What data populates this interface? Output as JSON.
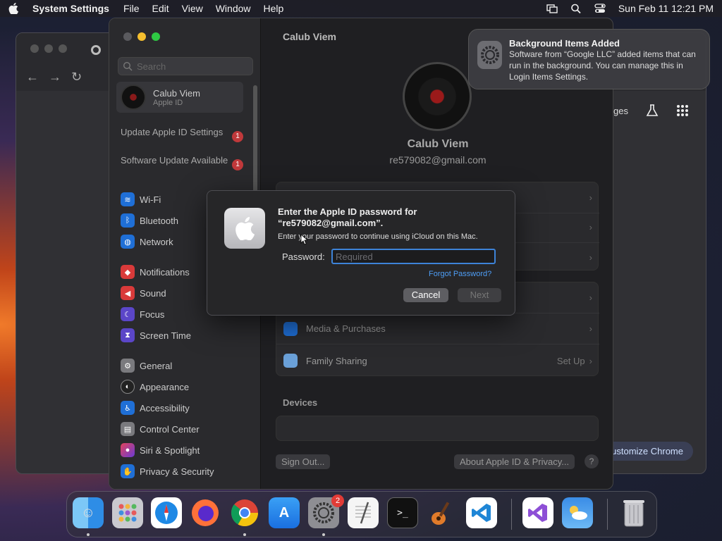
{
  "menubar": {
    "app_name": "System Settings",
    "menus": [
      "File",
      "Edit",
      "View",
      "Window",
      "Help"
    ],
    "datetime": "Sun Feb 11  12:21 PM"
  },
  "chrome": {
    "partial_label": "ges",
    "customize_label": "ustomize Chrome"
  },
  "settings": {
    "search_placeholder": "Search",
    "account_name": "Calub Viem",
    "account_sub": "Apple ID",
    "notices": [
      {
        "label": "Update Apple ID Settings",
        "badge": "1"
      },
      {
        "label": "Software Update Available",
        "badge": "1"
      }
    ],
    "nav": [
      "Wi-Fi",
      "Bluetooth",
      "Network",
      "Notifications",
      "Sound",
      "Focus",
      "Screen Time",
      "General",
      "Appearance",
      "Accessibility",
      "Control Center",
      "Siri & Spotlight",
      "Privacy & Security"
    ],
    "main_title": "Calub Viem",
    "user_name": "Calub Viem",
    "user_email": "re579082@gmail.com",
    "rows": {
      "media": "Media & Purchases",
      "family": "Family Sharing",
      "family_value": "Set Up"
    },
    "devices_label": "Devices",
    "sign_out": "Sign Out...",
    "about": "About Apple ID & Privacy...",
    "help": "?"
  },
  "notification": {
    "title": "Background Items Added",
    "body": "Software from “Google LLC” added items that can run in the background. You can manage this in Login Items Settings."
  },
  "dialog": {
    "title": "Enter the Apple ID password for “re579082@gmail.com”.",
    "message": "Enter your password to continue using iCloud on this Mac.",
    "password_label": "Password:",
    "password_placeholder": "Required",
    "forgot": "Forgot Password?",
    "cancel": "Cancel",
    "next": "Next"
  },
  "dock": {
    "settings_badge": "2"
  },
  "colors": {
    "accent": "#3d83d8",
    "link": "#4e9ef6",
    "badge": "#c0393b"
  }
}
